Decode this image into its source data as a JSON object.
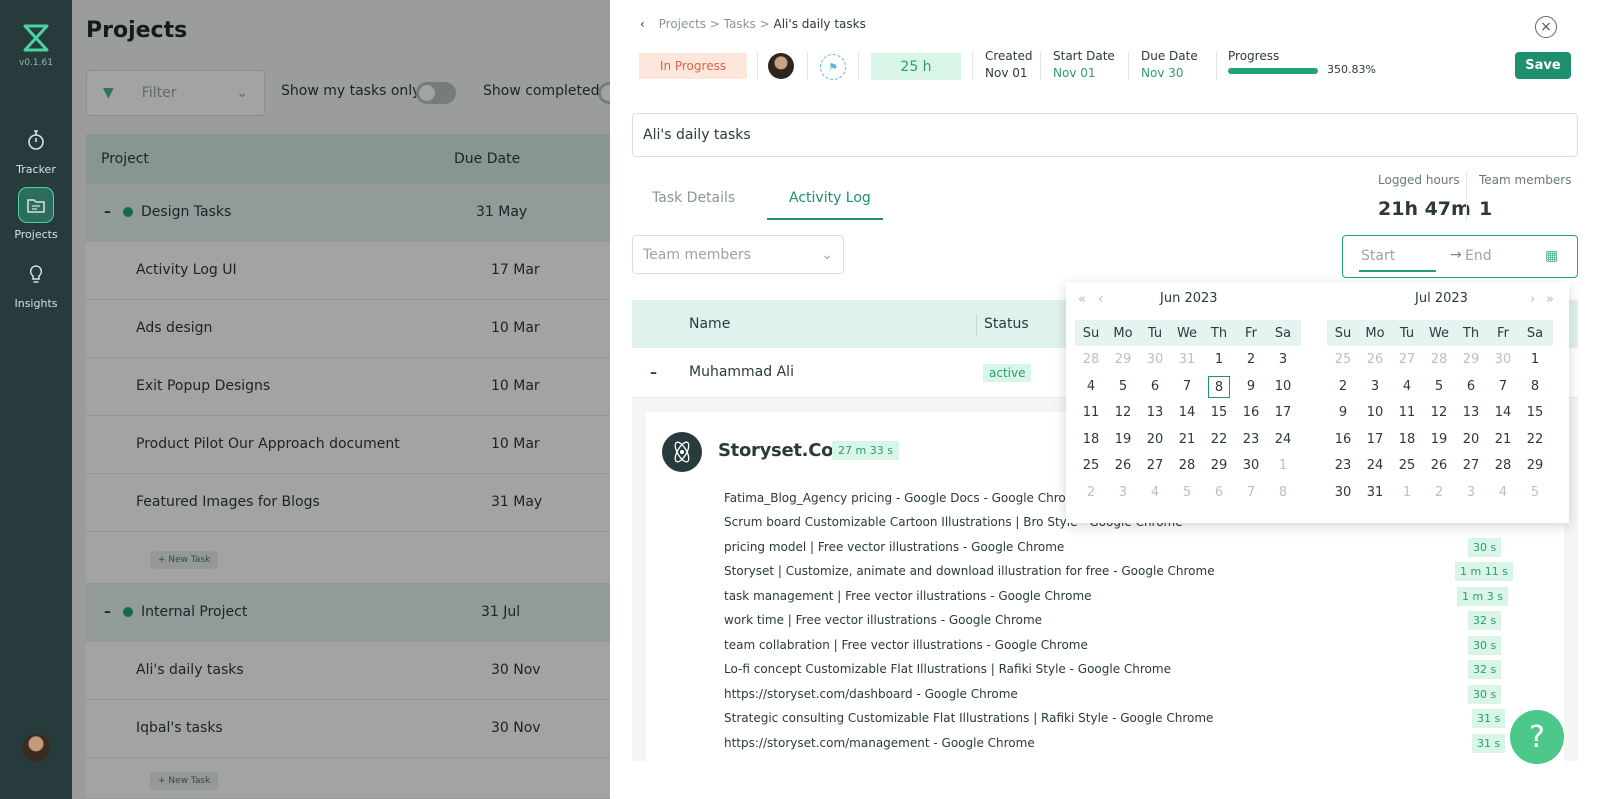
{
  "sidebar": {
    "version": "v0.1.61",
    "items": [
      {
        "label": "Tracker",
        "icon": "stopwatch-icon"
      },
      {
        "label": "Projects",
        "icon": "folder-icon"
      },
      {
        "label": "Insights",
        "icon": "lightbulb-icon"
      }
    ]
  },
  "projects_page": {
    "title": "Projects",
    "filter_placeholder": "Filter",
    "show_my_tasks_label": "Show my tasks only",
    "show_completed_label": "Show completed",
    "columns": [
      "Project",
      "Due Date"
    ],
    "rows": [
      {
        "name": "Design Tasks",
        "due": "31 May",
        "group": true
      },
      {
        "name": "Activity Log UI",
        "due": "17 Mar"
      },
      {
        "name": "Ads design",
        "due": "10 Mar"
      },
      {
        "name": "Exit Popup Designs",
        "due": "10 Mar"
      },
      {
        "name": "Product Pilot Our Approach document",
        "due": "10 Mar"
      },
      {
        "name": "Featured Images for Blogs",
        "due": "31 May"
      },
      {
        "name": "Internal Project",
        "due": "31 Jul",
        "group": true
      },
      {
        "name": "Ali's daily tasks",
        "due": "30 Nov"
      },
      {
        "name": "Iqbal's tasks",
        "due": "30 Nov"
      }
    ],
    "new_task_label": "+ New Task"
  },
  "panel": {
    "breadcrumb": [
      "Projects",
      "Tasks",
      "Ali's daily tasks"
    ],
    "status": "In Progress",
    "hours": "25 h",
    "created_label": "Created",
    "created_value": "Nov 01",
    "start_label": "Start Date",
    "start_value": "Nov 01",
    "due_label": "Due Date",
    "due_value": "Nov 30",
    "progress_label": "Progress",
    "progress_value": "350.83%",
    "progress_fraction": 1.0,
    "save_label": "Save",
    "task_title": "Ali's daily tasks",
    "tabs": [
      "Task Details",
      "Activity Log"
    ],
    "logged_hours_label": "Logged hours",
    "logged_hours_value": "21h 47m",
    "team_members_label": "Team members",
    "team_members_value": "1",
    "team_select_placeholder": "Team members",
    "range_start_placeholder": "Start",
    "range_end_placeholder": "End",
    "grid_columns": [
      "Name",
      "Status"
    ],
    "member": {
      "name": "Muhammad Ali",
      "status": "active"
    },
    "app": {
      "name": "Storyset.Com",
      "time": "27 m 33 s"
    },
    "logs": [
      {
        "text": "Fatima_Blog_Agency pricing - Google Docs - Google Chrome",
        "time": ""
      },
      {
        "text": "Scrum board Customizable Cartoon Illustrations | Bro Style - Google Chrome",
        "time": ""
      },
      {
        "text": "pricing model | Free vector illustrations - Google Chrome",
        "time": "30 s"
      },
      {
        "text": "Storyset | Customize, animate and download illustration for free - Google Chrome",
        "time": "1 m 11 s"
      },
      {
        "text": "task management | Free vector illustrations - Google Chrome",
        "time": "1 m 3 s"
      },
      {
        "text": "work time | Free vector illustrations - Google Chrome",
        "time": "32 s"
      },
      {
        "text": "team collabration | Free vector illustrations - Google Chrome",
        "time": "30 s"
      },
      {
        "text": "Lo-fi concept Customizable Flat Illustrations | Rafiki Style - Google Chrome",
        "time": "32 s"
      },
      {
        "text": "https://storyset.com/dashboard - Google Chrome",
        "time": "30 s"
      },
      {
        "text": "Strategic consulting Customizable Flat Illustrations | Rafiki Style - Google Chrome",
        "time": "31 s"
      },
      {
        "text": "https://storyset.com/management - Google Chrome",
        "time": "31 s"
      }
    ]
  },
  "calendar": {
    "months": [
      {
        "title": "Jun  2023",
        "selected_day": "8",
        "days": [
          [
            "28",
            "29",
            "30",
            "31",
            "1",
            "2",
            "3"
          ],
          [
            "4",
            "5",
            "6",
            "7",
            "8",
            "9",
            "10"
          ],
          [
            "11",
            "12",
            "13",
            "14",
            "15",
            "16",
            "17"
          ],
          [
            "18",
            "19",
            "20",
            "21",
            "22",
            "23",
            "24"
          ],
          [
            "25",
            "26",
            "27",
            "28",
            "29",
            "30",
            "1"
          ],
          [
            "2",
            "3",
            "4",
            "5",
            "6",
            "7",
            "8"
          ]
        ],
        "muted": [
          [
            0,
            0
          ],
          [
            0,
            1
          ],
          [
            0,
            2
          ],
          [
            0,
            3
          ],
          [
            4,
            6
          ],
          [
            5,
            0
          ],
          [
            5,
            1
          ],
          [
            5,
            2
          ],
          [
            5,
            3
          ],
          [
            5,
            4
          ],
          [
            5,
            5
          ],
          [
            5,
            6
          ]
        ]
      },
      {
        "title": "Jul  2023",
        "selected_day": "",
        "days": [
          [
            "25",
            "26",
            "27",
            "28",
            "29",
            "30",
            "1"
          ],
          [
            "2",
            "3",
            "4",
            "5",
            "6",
            "7",
            "8"
          ],
          [
            "9",
            "10",
            "11",
            "12",
            "13",
            "14",
            "15"
          ],
          [
            "16",
            "17",
            "18",
            "19",
            "20",
            "21",
            "22"
          ],
          [
            "23",
            "24",
            "25",
            "26",
            "27",
            "28",
            "29"
          ],
          [
            "30",
            "31",
            "1",
            "2",
            "3",
            "4",
            "5"
          ]
        ],
        "muted": [
          [
            0,
            0
          ],
          [
            0,
            1
          ],
          [
            0,
            2
          ],
          [
            0,
            3
          ],
          [
            0,
            4
          ],
          [
            0,
            5
          ],
          [
            5,
            2
          ],
          [
            5,
            3
          ],
          [
            5,
            4
          ],
          [
            5,
            5
          ],
          [
            5,
            6
          ]
        ]
      }
    ],
    "weekdays": [
      "Su",
      "Mo",
      "Tu",
      "We",
      "Th",
      "Fr",
      "Sa"
    ],
    "nav": {
      "prev_year": "«",
      "prev_month": "‹",
      "next_month": "›",
      "next_year": "»"
    }
  },
  "colors": {
    "accent": "#1e8f6f",
    "sidebar": "#273a3c",
    "status_bg": "#fde6dc",
    "status_text": "#e0644c"
  }
}
